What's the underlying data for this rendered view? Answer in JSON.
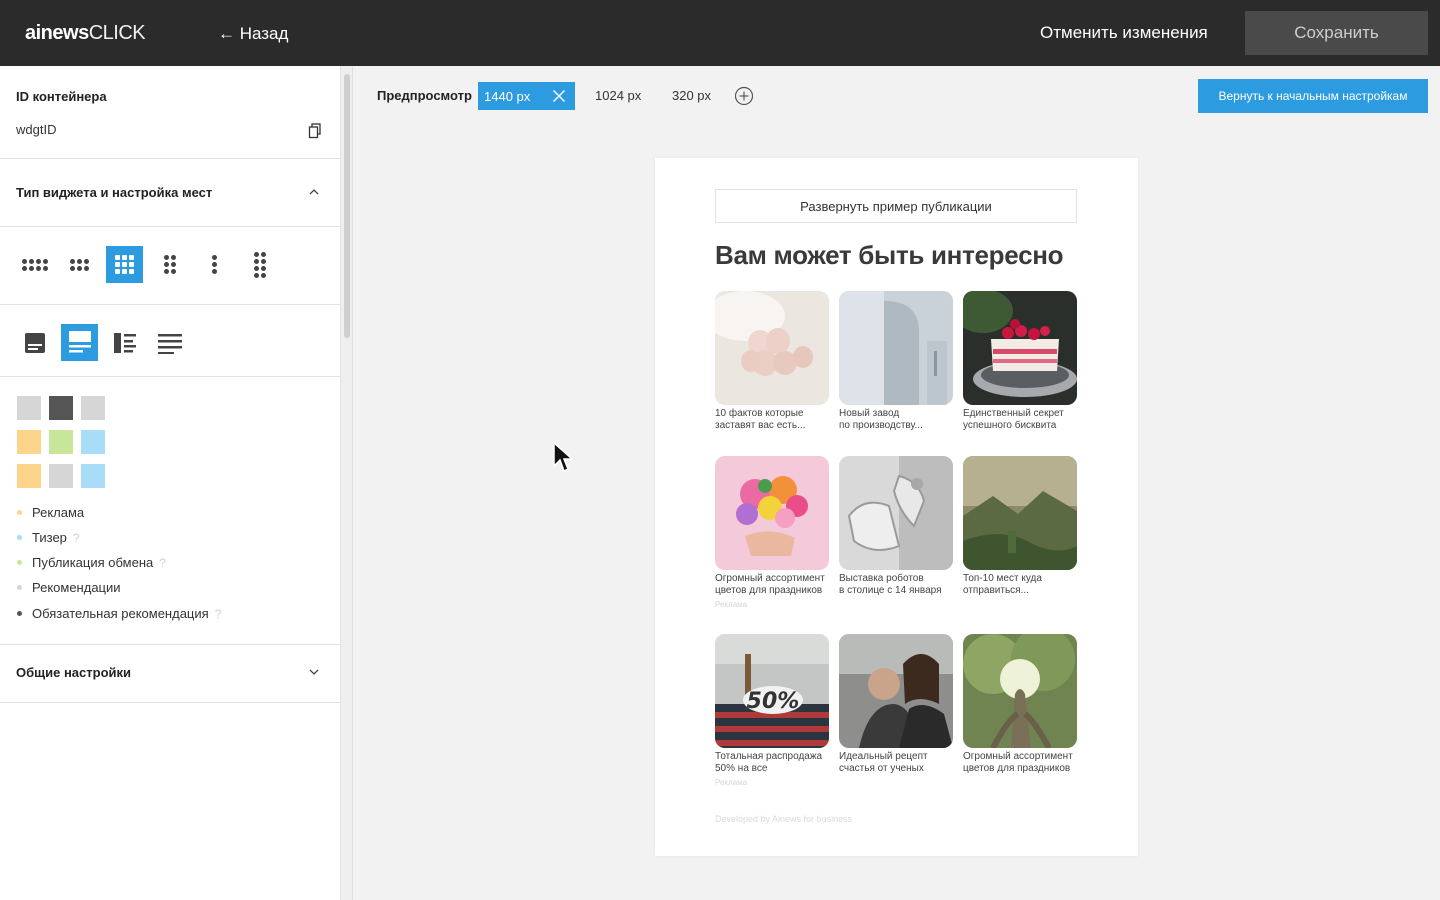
{
  "app": {
    "logo_bold": "ainews",
    "logo_light": "CLICK",
    "back_label": "← Назад",
    "cancel_label": "Отменить изменения",
    "save_label": "Сохранить"
  },
  "sidebar": {
    "container_id_label": "ID контейнера",
    "container_id_value": "wdgtID",
    "widget_type_label": "Тип виджета и настройка мест",
    "swatches": {
      "row1": [
        "#d6d6d6",
        "#555555",
        "#d6d6d6"
      ],
      "row2": [
        "#fcd58a",
        "#c8e69a",
        "#a9dcf7"
      ],
      "row3": [
        "#fcd58a",
        "#d6d6d6",
        "#a9dcf7"
      ]
    },
    "legend": [
      {
        "label": "Реклама",
        "color": "#fcd58a",
        "help": false
      },
      {
        "label": "Тизер",
        "color": "#a9dcf7",
        "help": true
      },
      {
        "label": "Публикация обмена",
        "color": "#c8e69a",
        "help": true
      },
      {
        "label": "Рекомендации",
        "color": "#d6d6d6",
        "help": false
      },
      {
        "label": "Обязательная рекомендация",
        "color": "#555555",
        "help": true
      }
    ],
    "help_mark": "?",
    "general_settings_label": "Общие настройки"
  },
  "preview": {
    "label": "Предпросмотр",
    "sizes": [
      "1440 px",
      "1024 px",
      "320 px"
    ],
    "reset_label": "Вернуть к начальным настройкам",
    "expand_label": "Развернуть пример публикации",
    "widget_title": "Вам может быть интересно",
    "tiles": [
      {
        "caption1": "10 фактов которые",
        "caption2": "заставят вас есть...",
        "tag": ""
      },
      {
        "caption1": "Новый завод",
        "caption2": "по производству...",
        "tag": ""
      },
      {
        "caption1": "Единственный секрет",
        "caption2": "успешного бисквита",
        "tag": ""
      },
      {
        "caption1": "Огромный ассортимент",
        "caption2": "цветов для праздников",
        "tag": "Реклама"
      },
      {
        "caption1": "Выставка роботов",
        "caption2": "в столице с 14 января",
        "tag": ""
      },
      {
        "caption1": "Топ-10 мест куда",
        "caption2": "отправиться...",
        "tag": ""
      },
      {
        "caption1": "Тотальная распродажа",
        "caption2": "50% на все",
        "tag": "Реклама"
      },
      {
        "caption1": "Идеальный рецепт",
        "caption2": "счастья от ученых",
        "tag": ""
      },
      {
        "caption1": "Огромный ассортимент",
        "caption2": "цветов для праздников",
        "tag": ""
      }
    ],
    "sale_badge": "50%",
    "powered_by": "Developed by Ainews for business"
  },
  "colors": {
    "accent": "#2d9be0",
    "topbar": "#2b2b2b"
  }
}
